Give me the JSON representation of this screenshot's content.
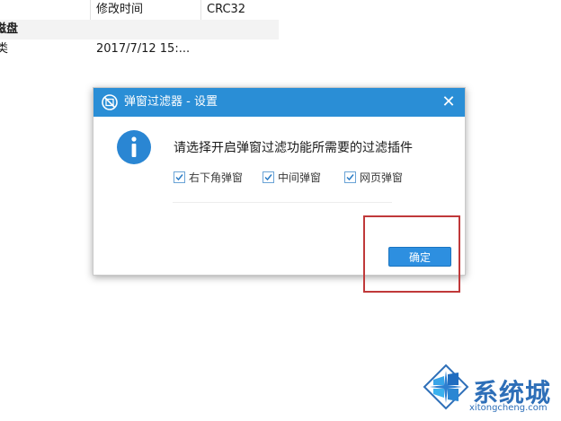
{
  "file_list": {
    "headers": [
      "修改时间",
      "CRC32"
    ],
    "group_label": "磁盘",
    "file_row": {
      "name_fragment": "类",
      "modified": "2017/7/12 15:..."
    }
  },
  "dialog": {
    "title": "弹窗过滤器 - 设置",
    "close_label": "✕",
    "message": "请选择开启弹窗过滤功能所需要的过滤插件",
    "options": [
      {
        "label": "右下角弹窗",
        "checked": true
      },
      {
        "label": "中间弹窗",
        "checked": true
      },
      {
        "label": "网页弹窗",
        "checked": true
      }
    ],
    "ok_label": "确定"
  },
  "watermark": {
    "brand": "系统城",
    "url": "xitongcheng.com"
  },
  "colors": {
    "title_bar": "#2a8ed6",
    "button": "#2d8fe0",
    "highlight": "#c0393a",
    "watermark": "#2e6fb8"
  },
  "icons": {
    "title": "no-popup-icon",
    "info": "info-icon",
    "close": "close-icon",
    "logo": "windows-diamond-logo"
  }
}
